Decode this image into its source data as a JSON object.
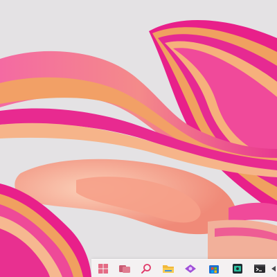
{
  "wallpaper": {
    "name": "bloom-wallpaper",
    "colors": {
      "background": "#e4e2e4",
      "magenta": "#e8208a",
      "pink": "#f274a8",
      "coral": "#f08a78",
      "orange": "#f0a060",
      "peach": "#f6b89a"
    }
  },
  "taskbar": {
    "items": [
      {
        "icon": "start-windows-icon"
      },
      {
        "icon": "task-view-icon"
      },
      {
        "icon": "search-icon"
      },
      {
        "icon": "file-explorer-folder-icon"
      },
      {
        "icon": "purple-app-icon"
      },
      {
        "icon": "store-app-icon"
      },
      {
        "icon": "media-app-icon"
      },
      {
        "icon": "terminal-icon"
      },
      {
        "icon": "partial-app-icon"
      }
    ]
  }
}
